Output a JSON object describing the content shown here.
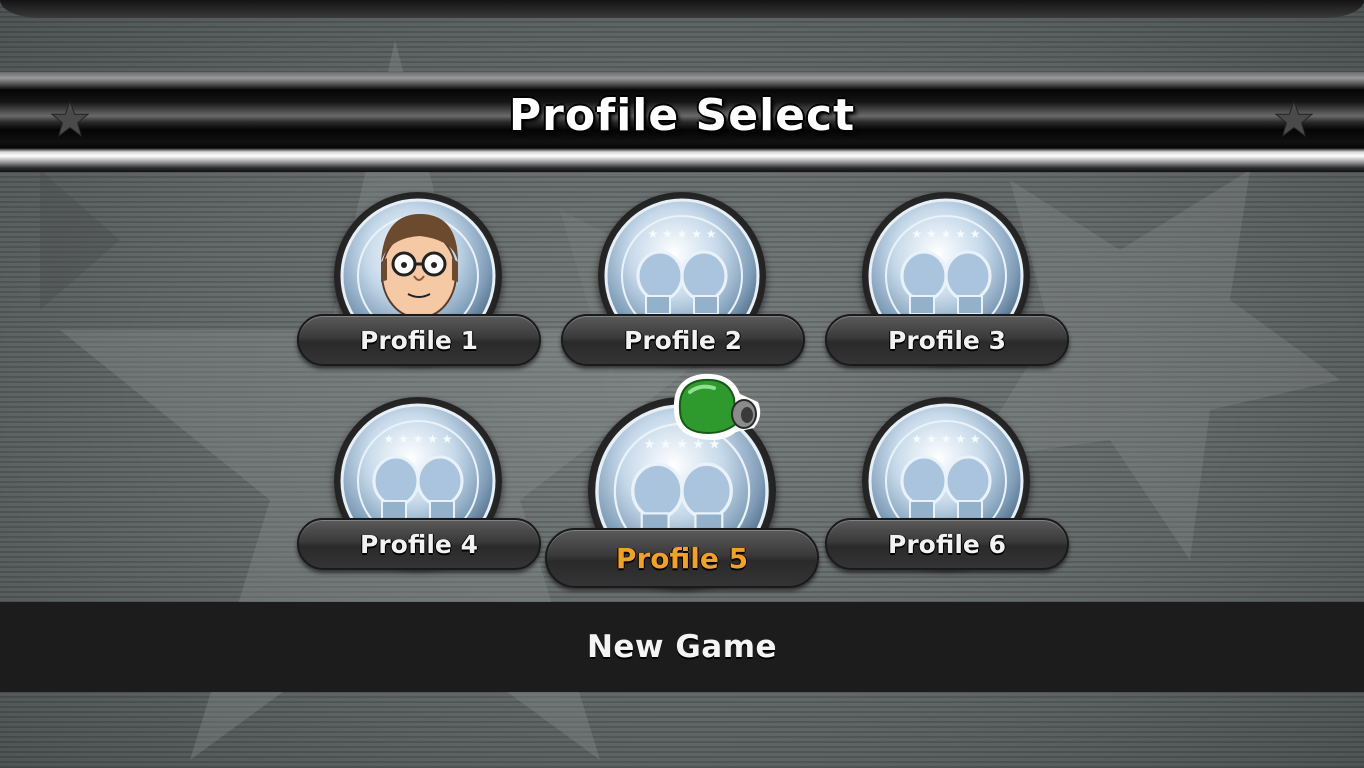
{
  "screen": {
    "title": "Profile Select",
    "icons": {
      "corner_left": "star-icon",
      "corner_right": "star-icon",
      "cursor": "boxing-glove-cursor-icon",
      "medal": "silver-boxing-medal-icon",
      "avatar": "mii-avatar-icon"
    }
  },
  "profiles": [
    {
      "label": "Profile 1",
      "has_avatar": true,
      "selected": false
    },
    {
      "label": "Profile 2",
      "has_avatar": false,
      "selected": false
    },
    {
      "label": "Profile 3",
      "has_avatar": false,
      "selected": false
    },
    {
      "label": "Profile 4",
      "has_avatar": false,
      "selected": false
    },
    {
      "label": "Profile 5",
      "has_avatar": false,
      "selected": true
    },
    {
      "label": "Profile 6",
      "has_avatar": false,
      "selected": false
    }
  ],
  "new_game": {
    "label": "New Game"
  },
  "colors": {
    "selected_text": "#f5a21b",
    "normal_text": "#f2f2f2",
    "cursor_glove": "#2e9a2e"
  }
}
